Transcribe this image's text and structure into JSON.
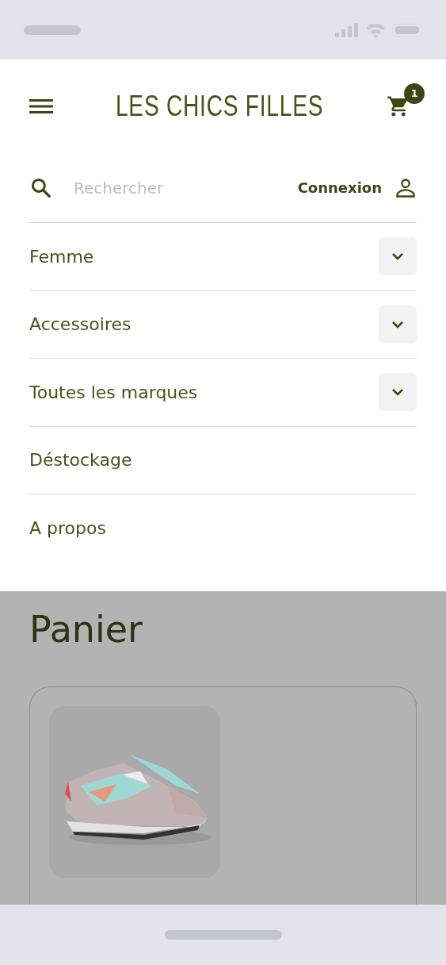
{
  "header": {
    "logo": "LES CHICS FILLES",
    "cart_count": "1"
  },
  "search": {
    "placeholder": "Rechercher"
  },
  "login": {
    "label": "Connexion"
  },
  "menu": [
    {
      "label": "Femme",
      "has_submenu": true
    },
    {
      "label": "Accessoires",
      "has_submenu": true
    },
    {
      "label": "Toutes les marques",
      "has_submenu": true
    },
    {
      "label": "Déstockage",
      "has_submenu": false
    },
    {
      "label": "A propos",
      "has_submenu": false
    }
  ],
  "page": {
    "title": "Panier"
  }
}
